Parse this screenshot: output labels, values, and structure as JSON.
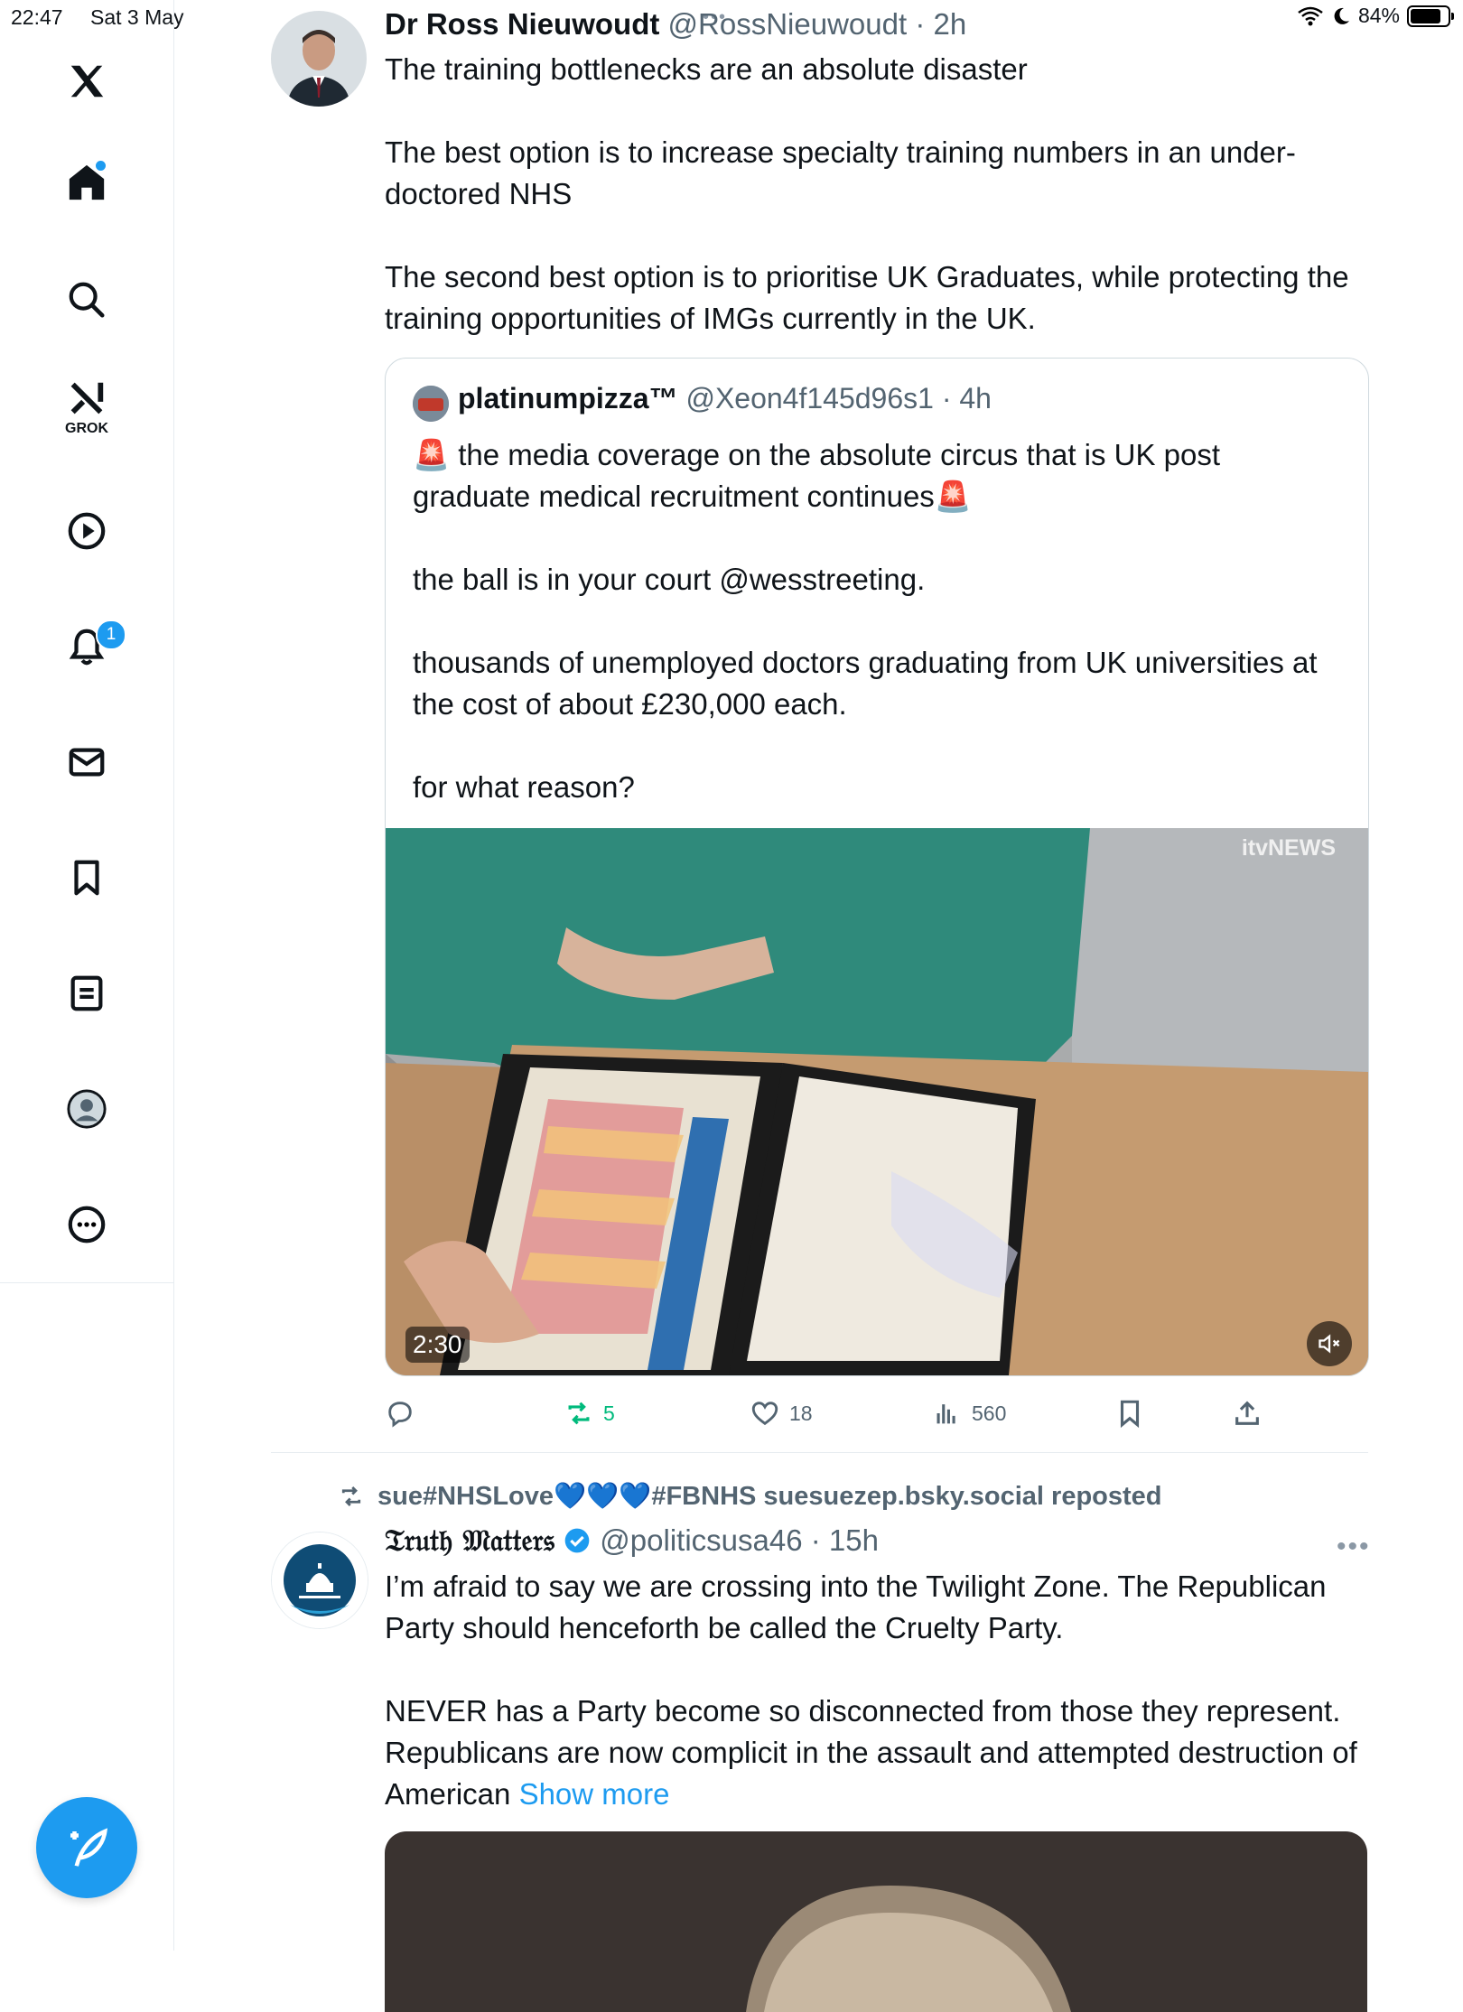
{
  "status": {
    "time": "22:47",
    "date": "Sat 3 May",
    "battery": "84%",
    "battery_level": 0.84
  },
  "sidebar": {
    "items": [
      {
        "name": "home",
        "active": true
      },
      {
        "name": "search"
      },
      {
        "name": "grok",
        "label": "GROK"
      },
      {
        "name": "videos"
      },
      {
        "name": "notifications",
        "badge": "1"
      },
      {
        "name": "messages"
      },
      {
        "name": "bookmarks"
      },
      {
        "name": "lists"
      },
      {
        "name": "profile"
      },
      {
        "name": "more"
      }
    ]
  },
  "tweet1": {
    "name": "Dr Ross Nieuwoudt",
    "handle": "@RossNieuwoudt",
    "time": "· 2h",
    "text": "The training bottlenecks are an absolute disaster\n\nThe best option is to increase specialty training numbers in an under-doctored NHS\n\nThe second best option is to prioritise UK Graduates, while protecting the training opportunities of IMGs currently in the UK.",
    "quote": {
      "name": "platinumpizza™",
      "handle": "@Xeon4f145d96s1",
      "time": "· 4h",
      "text": "🚨 the media coverage on the absolute circus that is UK post graduate medical recruitment continues🚨\n\nthe ball is in your court @wesstreeting.\n\nthousands of unemployed doctors graduating from UK universities at the cost of about £230,000 each.\n\nfor what reason?",
      "video_duration": "2:30",
      "watermark": "itvNEWS"
    },
    "actions": {
      "retweets": "5",
      "likes": "18",
      "views": "560"
    }
  },
  "tweet2": {
    "repost_by": "sue#NHSLove💙💙💙#FBNHS suesuezep.bsky.social reposted",
    "name": "𝔗𝔯𝔲𝔱𝔥 𝔐𝔞𝔱𝔱𝔢𝔯𝔰",
    "handle": "@politicsusa46",
    "time": "· 15h",
    "text": "I’m afraid to say we are crossing into the Twilight Zone. The Republican Party should henceforth be called the Cruelty Party.\n\nNEVER has a Party become so disconnected from those they represent. Republicans are now complicit in the assault and attempted destruction of American ",
    "show_more": "Show more"
  },
  "colors": {
    "accent": "#1d9bf0",
    "retweet": "#00ba7c",
    "muted": "#536471"
  }
}
